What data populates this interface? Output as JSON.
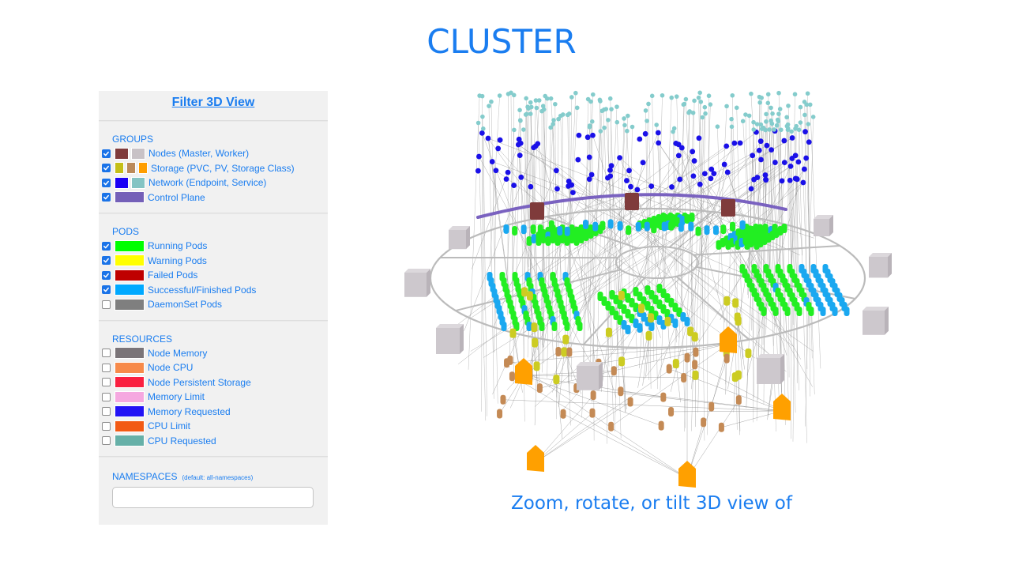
{
  "title": "CLUSTER",
  "caption": "Zoom, rotate, or tilt 3D view of",
  "panel": {
    "title": "Filter 3D View",
    "groups": {
      "heading": "GROUPS",
      "items": [
        {
          "label": "Nodes (Master, Worker)",
          "checked": true,
          "colors": [
            "#7f3b3b",
            "#c8c2c6"
          ]
        },
        {
          "label": "Storage (PVC, PV, Storage Class)",
          "checked": true,
          "colors": [
            "#c4bf17",
            "#bb8a5a",
            "#ff9e00"
          ]
        },
        {
          "label": "Network (Endpoint, Service)",
          "checked": true,
          "colors": [
            "#1a00f5",
            "#84c4c4"
          ]
        },
        {
          "label": "Control Plane",
          "checked": true,
          "colors": [
            "#7460b8"
          ]
        }
      ]
    },
    "pods": {
      "heading": "PODS",
      "items": [
        {
          "label": "Running Pods",
          "checked": true,
          "colors": [
            "#00ff00"
          ]
        },
        {
          "label": "Warning Pods",
          "checked": true,
          "colors": [
            "#ffff00"
          ]
        },
        {
          "label": "Failed Pods",
          "checked": true,
          "colors": [
            "#bf0000"
          ]
        },
        {
          "label": "Successful/Finished Pods",
          "checked": true,
          "colors": [
            "#00a9ff"
          ]
        },
        {
          "label": "DaemonSet Pods",
          "checked": false,
          "colors": [
            "#7f7f7f"
          ]
        }
      ]
    },
    "resources": {
      "heading": "RESOURCES",
      "items": [
        {
          "label": "Node Memory",
          "checked": false,
          "colors": [
            "#7a7478"
          ]
        },
        {
          "label": "Node CPU",
          "checked": false,
          "colors": [
            "#f78a4a"
          ]
        },
        {
          "label": "Node Persistent Storage",
          "checked": false,
          "colors": [
            "#fa2040"
          ]
        },
        {
          "label": "Memory Limit",
          "checked": false,
          "colors": [
            "#f5a8e0"
          ]
        },
        {
          "label": "Memory Requested",
          "checked": false,
          "colors": [
            "#2212f5"
          ]
        },
        {
          "label": "CPU Limit",
          "checked": false,
          "colors": [
            "#f25a14"
          ]
        },
        {
          "label": "CPU Requested",
          "checked": false,
          "colors": [
            "#66b0a8"
          ]
        }
      ]
    },
    "namespaces": {
      "heading": "NAMESPACES",
      "hint": "(default: all-namespaces)",
      "value": "",
      "placeholder": ""
    }
  },
  "visualization": {
    "name": "3D cluster view",
    "colors": {
      "service": "#84cccc",
      "endpoint": "#1a10e8",
      "master": "#7f3b3b",
      "worker": "#cdc8cd",
      "control_plane": "#7a62c0",
      "running": "#22ee22",
      "successful": "#1aa8f0",
      "pvc": "#cccc22",
      "pv": "#c48a55",
      "storage_class": "#ffa000",
      "ring": "#bbbbbb",
      "link": "#888888"
    }
  }
}
